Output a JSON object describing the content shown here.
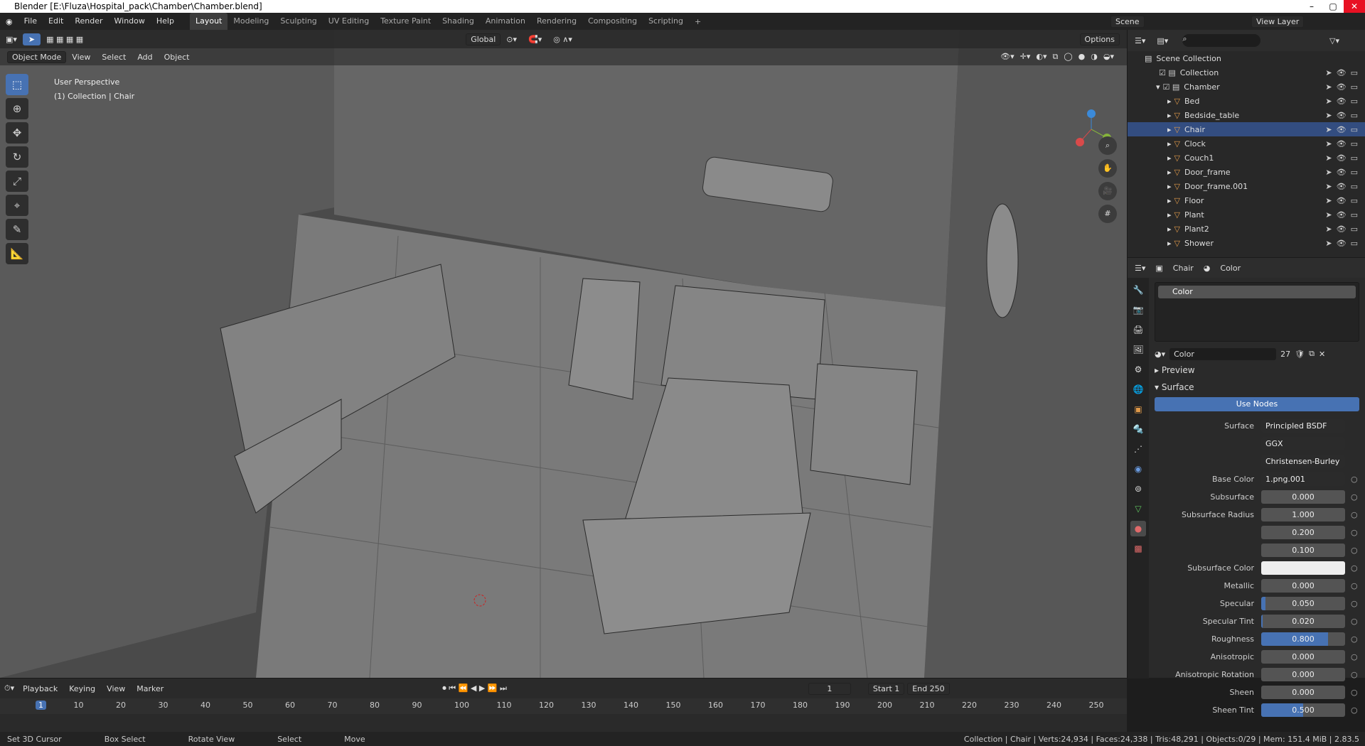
{
  "title": "Blender [E:\\Fluza\\Hospital_pack\\Chamber\\Chamber.blend]",
  "menu": [
    "File",
    "Edit",
    "Render",
    "Window",
    "Help"
  ],
  "workspaces": [
    "Layout",
    "Modeling",
    "Sculpting",
    "UV Editing",
    "Texture Paint",
    "Shading",
    "Animation",
    "Rendering",
    "Compositing",
    "Scripting"
  ],
  "scene": "Scene",
  "view_layer": "View Layer",
  "viewport": {
    "mode": "Object Mode",
    "menus": [
      "View",
      "Select",
      "Add",
      "Object"
    ],
    "transform": "Global",
    "options": "Options",
    "perspective": "User Perspective",
    "collection": "(1) Collection | Chair"
  },
  "outliner": {
    "root": "Scene Collection",
    "items": [
      "Collection",
      "Chamber",
      "Bed",
      "Bedside_table",
      "Chair",
      "Clock",
      "Couch1",
      "Door_frame",
      "Door_frame.001",
      "Floor",
      "Plant",
      "Plant2",
      "Shower"
    ]
  },
  "props": {
    "object": "Chair",
    "material": "Color",
    "slot": "Color",
    "mat_name": "Color",
    "users": "27",
    "preview": "Preview",
    "surface": "Surface",
    "use_nodes": "Use Nodes",
    "surface_shader": "Principled BSDF",
    "distribution": "GGX",
    "subsurface_method": "Christensen-Burley",
    "rows": [
      {
        "l": "Base Color",
        "v": "1.png.001",
        "t": "sel"
      },
      {
        "l": "Subsurface",
        "v": "0.000",
        "f": 0
      },
      {
        "l": "Subsurface Radius",
        "v": "1.000",
        "f": 0
      },
      {
        "l": "",
        "v": "0.200",
        "f": 0
      },
      {
        "l": "",
        "v": "0.100",
        "f": 0
      },
      {
        "l": "Subsurface Color",
        "v": "",
        "t": "white"
      },
      {
        "l": "Metallic",
        "v": "0.000",
        "f": 0
      },
      {
        "l": "Specular",
        "v": "0.050",
        "f": 0.05
      },
      {
        "l": "Specular Tint",
        "v": "0.020",
        "f": 0.02
      },
      {
        "l": "Roughness",
        "v": "0.800",
        "f": 0.8
      },
      {
        "l": "Anisotropic",
        "v": "0.000",
        "f": 0
      },
      {
        "l": "Anisotropic Rotation",
        "v": "0.000",
        "f": 0
      },
      {
        "l": "Sheen",
        "v": "0.000",
        "f": 0
      },
      {
        "l": "Sheen Tint",
        "v": "0.500",
        "f": 0.5
      }
    ]
  },
  "timeline": {
    "menus": [
      "Playback",
      "Keying",
      "View",
      "Marker"
    ],
    "frame": "1",
    "start": "1",
    "end": "250",
    "start_label": "Start",
    "end_label": "End",
    "ticks": [
      "1",
      "10",
      "20",
      "30",
      "40",
      "50",
      "60",
      "70",
      "80",
      "90",
      "100",
      "110",
      "120",
      "130",
      "140",
      "150",
      "160",
      "170",
      "180",
      "190",
      "200",
      "210",
      "220",
      "230",
      "240",
      "250"
    ]
  },
  "status": {
    "left": [
      "Set 3D Cursor",
      "Box Select",
      "Rotate View",
      "Select",
      "Move"
    ],
    "right": "Collection | Chair | Verts:24,934 | Faces:24,338 | Tris:48,291 | Objects:0/29 | Mem: 151.4 MiB | 2.83.5"
  }
}
